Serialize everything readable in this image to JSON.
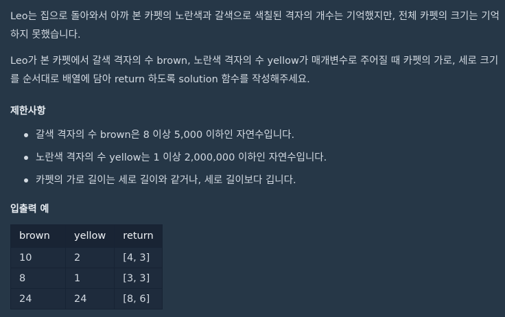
{
  "description": {
    "paragraph1": "Leo는 집으로 돌아와서 아까 본 카펫의 노란색과 갈색으로 색칠된 격자의 개수는 기억했지만, 전체 카펫의 크기는 기억하지 못했습니다.",
    "paragraph2": "Leo가 본 카펫에서 갈색 격자의 수 brown, 노란색 격자의 수 yellow가 매개변수로 주어질 때 카펫의 가로, 세로 크기를 순서대로 배열에 담아 return 하도록 solution 함수를 작성해주세요."
  },
  "constraints": {
    "heading": "제한사항",
    "items": [
      "갈색 격자의 수 brown은 8 이상 5,000 이하인 자연수입니다.",
      "노란색 격자의 수 yellow는 1 이상 2,000,000 이하인 자연수입니다.",
      "카펫의 가로 길이는 세로 길이와 같거나, 세로 길이보다 깁니다."
    ]
  },
  "examples": {
    "heading": "입출력 예",
    "columns": [
      "brown",
      "yellow",
      "return"
    ],
    "rows": [
      [
        "10",
        "2",
        "[4, 3]"
      ],
      [
        "8",
        "1",
        "[3, 3]"
      ],
      [
        "24",
        "24",
        "[8, 6]"
      ]
    ]
  }
}
